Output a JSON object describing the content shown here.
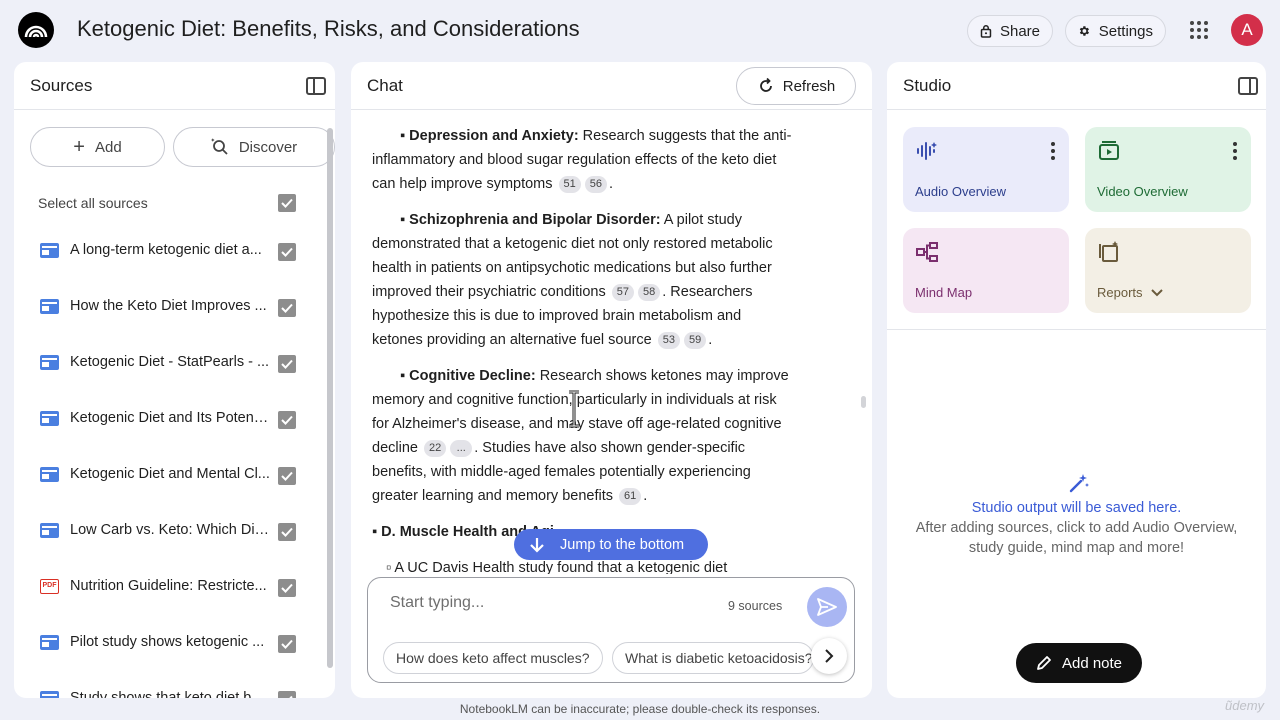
{
  "header": {
    "title": "Ketogenic Diet: Benefits, Risks, and Considerations",
    "share_label": "Share",
    "settings_label": "Settings",
    "avatar_initial": "A"
  },
  "sources": {
    "title": "Sources",
    "add_label": "Add",
    "discover_label": "Discover",
    "select_all_label": "Select all sources",
    "items": [
      {
        "label": "A long-term ketogenic diet a...",
        "type": "web"
      },
      {
        "label": "How the Keto Diet Improves ...",
        "type": "web"
      },
      {
        "label": "Ketogenic Diet - StatPearls - ...",
        "type": "web"
      },
      {
        "label": "Ketogenic Diet and Its Potenti...",
        "type": "web"
      },
      {
        "label": "Ketogenic Diet and Mental Cl...",
        "type": "web"
      },
      {
        "label": "Low Carb vs. Keto: Which Die...",
        "type": "web"
      },
      {
        "label": "Nutrition Guideline: Restricte...",
        "type": "pdf"
      },
      {
        "label": "Pilot study shows ketogenic ...",
        "type": "web"
      },
      {
        "label": "Study shows that keto diet b...",
        "type": "web"
      }
    ]
  },
  "chat": {
    "title": "Chat",
    "refresh_label": "Refresh",
    "paragraphs": {
      "p1": {
        "bold": "Depression and Anxiety:",
        "text1": " Research suggests that the anti-inflammatory and blood sugar regulation effects of the keto diet can help improve symptoms",
        "cites": [
          "51",
          "56"
        ]
      },
      "p2": {
        "bold": "Schizophrenia and Bipolar Disorder:",
        "text1": " A pilot study demonstrated that a ketogenic diet not only restored metabolic health in patients on antipsychotic medications but also further improved their psychiatric conditions",
        "cites1": [
          "57",
          "58"
        ],
        "text2": ". Researchers hypothesize this is due to improved brain metabolism and ketones providing an alternative fuel source",
        "cites2": [
          "53",
          "59"
        ]
      },
      "p3": {
        "bold": "Cognitive Decline:",
        "text1": " Research shows ketones may improve memory and cognitive function, particularly in individuals at risk for Alzheimer's disease, and may stave off age-related cognitive decline",
        "cites1": [
          "22",
          "..."
        ],
        "text2": ". Studies have also shown gender-specific benefits, with middle-aged females potentially experiencing greater learning and memory benefits",
        "cites2": [
          "61"
        ]
      },
      "p4": {
        "text": "D. Muscle Health and Agi..."
      },
      "p5": {
        "text": "A UC Davis Health study found that a ketogenic diet"
      }
    },
    "jump_label": "Jump to the bottom",
    "input_placeholder": "Start typing...",
    "source_count": "9 sources",
    "suggestions": [
      "How does keto affect muscles?",
      "What is diabetic ketoacidosis?"
    ]
  },
  "studio": {
    "title": "Studio",
    "cards": {
      "audio": "Audio Overview",
      "video": "Video Overview",
      "mind_map": "Mind Map",
      "reports": "Reports"
    },
    "empty_title": "Studio output will be saved here.",
    "empty_desc": "After adding sources, click to add Audio Overview, study guide, mind map and more!",
    "add_note_label": "Add note"
  },
  "footer": {
    "disclaimer": "NotebookLM can be inaccurate; please double-check its responses."
  },
  "colors": {
    "accent": "#4f6fe0",
    "avatar": "#d32f4a",
    "checkbox": "#8d8d8d"
  }
}
